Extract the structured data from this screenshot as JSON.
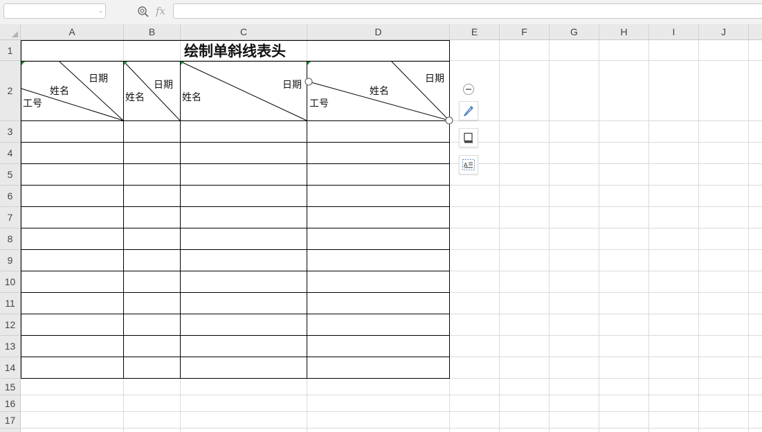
{
  "formula_bar": {
    "name_box_value": "",
    "name_box_dropdown": "⌄",
    "fx_label": "fx",
    "formula_value": ""
  },
  "columns": [
    "A",
    "B",
    "C",
    "D",
    "E",
    "F",
    "G",
    "H",
    "I",
    "J"
  ],
  "rows": [
    "1",
    "2",
    "3",
    "4",
    "5",
    "6",
    "7",
    "8",
    "9",
    "10",
    "11",
    "12",
    "13",
    "14",
    "15",
    "16",
    "17"
  ],
  "sheet": {
    "title": "绘制单斜线表头",
    "header_cells": {
      "A": {
        "date": "日期",
        "name": "姓名",
        "id": "工号"
      },
      "B": {
        "date": "日期",
        "name": "姓名"
      },
      "C": {
        "date": "日期",
        "name": "姓名"
      },
      "D": {
        "date": "日期",
        "name": "姓名",
        "id": "工号"
      }
    }
  },
  "floating_toolbar": {
    "items": [
      "collapse-icon",
      "pen-icon",
      "border-style-icon",
      "text-align-icon"
    ]
  },
  "colors": {
    "header_bg": "#e9e9e9",
    "gridline": "#dadada",
    "table_border": "#000000",
    "cell_marker": "#1d8f3a"
  }
}
